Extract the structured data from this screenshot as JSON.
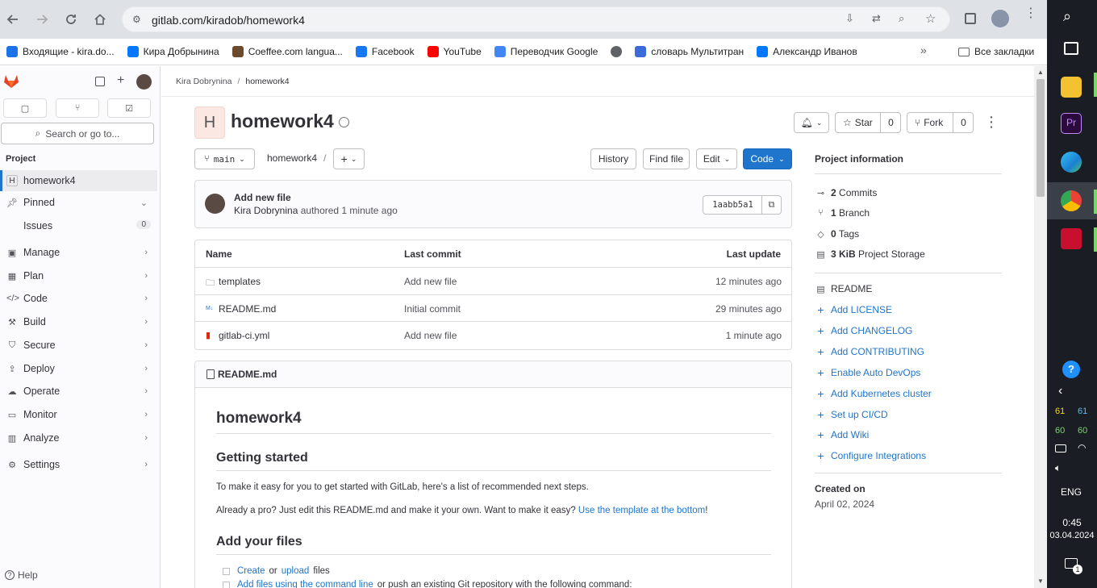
{
  "browser": {
    "url": "gitlab.com/kiradob/homework4",
    "bookmarks": [
      {
        "label": "Входящие - kira.do...",
        "color": "#1a73e8"
      },
      {
        "label": "Кира Добрынина",
        "color": "#0077ff"
      },
      {
        "label": "Coeffee.com langua...",
        "color": "#6b4a2b"
      },
      {
        "label": "Facebook",
        "color": "#1877f2"
      },
      {
        "label": "YouTube",
        "color": "#ff0000"
      },
      {
        "label": "Переводчик Google",
        "color": "#4285f4"
      },
      {
        "label": "",
        "color": "#5f6368"
      },
      {
        "label": "словарь Мультитран",
        "color": "#3c6ad8"
      },
      {
        "label": "Александр Иванов",
        "color": "#0077ff"
      }
    ],
    "all_bookmarks": "Все закладки"
  },
  "taskbar": {
    "stats": [
      "61",
      "61",
      "60",
      "60"
    ],
    "lang": "ENG",
    "time": "0:45",
    "date": "03.04.2024",
    "notif_count": "1"
  },
  "sidebar": {
    "search_placeholder": "Search or go to...",
    "section": "Project",
    "project_initial": "H",
    "project": "homework4",
    "pinned": "Pinned",
    "issues": "Issues",
    "issues_count": "0",
    "nav": [
      "Manage",
      "Plan",
      "Code",
      "Build",
      "Secure",
      "Deploy",
      "Operate",
      "Monitor",
      "Analyze"
    ],
    "settings": "Settings",
    "help": "Help"
  },
  "breadcrumb": {
    "user": "Kira Dobrynina",
    "sep": "/",
    "project": "homework4"
  },
  "header": {
    "initial": "H",
    "title": "homework4",
    "star": "Star",
    "star_count": "0",
    "fork": "Fork",
    "fork_count": "0"
  },
  "toolbar": {
    "branch": "main",
    "path": "homework4",
    "path_sep": "/",
    "history": "History",
    "find_file": "Find file",
    "edit": "Edit",
    "code": "Code"
  },
  "commit": {
    "title": "Add new file",
    "author": "Kira Dobrynina",
    "authored": "authored 1 minute ago",
    "sha": "1aabb5a1"
  },
  "files": {
    "headers": [
      "Name",
      "Last commit",
      "Last update"
    ],
    "rows": [
      {
        "name": "templates",
        "icon": "folder-icon",
        "commit": "Add new file",
        "updated": "12 minutes ago"
      },
      {
        "name": "README.md",
        "icon": "markdown-icon",
        "commit": "Initial commit",
        "updated": "29 minutes ago"
      },
      {
        "name": "gitlab-ci.yml",
        "icon": "yaml-file-icon",
        "commit": "Add new file",
        "updated": "1 minute ago"
      }
    ]
  },
  "readme": {
    "filename": "README.md",
    "h1": "homework4",
    "h2a": "Getting started",
    "p1": "To make it easy for you to get started with GitLab, here's a list of recommended next steps.",
    "p2": "Already a pro? Just edit this README.md and make it your own. Want to make it easy?",
    "p2_link": "Use the template at the bottom",
    "p2_end": "!",
    "h2b": "Add your files",
    "li1_a": "Create",
    "li1_or": "or",
    "li1_b": "upload",
    "li1_end": "files",
    "li2_a": "Add files using the command line",
    "li2_end": "or push an existing Git repository with the following command:"
  },
  "project_info": {
    "title": "Project information",
    "stats": [
      {
        "icon": "commit-icon",
        "count": "2",
        "label": "Commits"
      },
      {
        "icon": "branch-icon",
        "count": "1",
        "label": "Branch"
      },
      {
        "icon": "tag-icon",
        "count": "0",
        "label": "Tags"
      },
      {
        "icon": "storage-icon",
        "count": "3 KiB",
        "label": "Project Storage"
      }
    ],
    "readme": "README",
    "actions": [
      "Add LICENSE",
      "Add CHANGELOG",
      "Add CONTRIBUTING",
      "Enable Auto DevOps",
      "Add Kubernetes cluster",
      "Set up CI/CD",
      "Add Wiki",
      "Configure Integrations"
    ],
    "created_label": "Created on",
    "created_date": "April 02, 2024"
  }
}
